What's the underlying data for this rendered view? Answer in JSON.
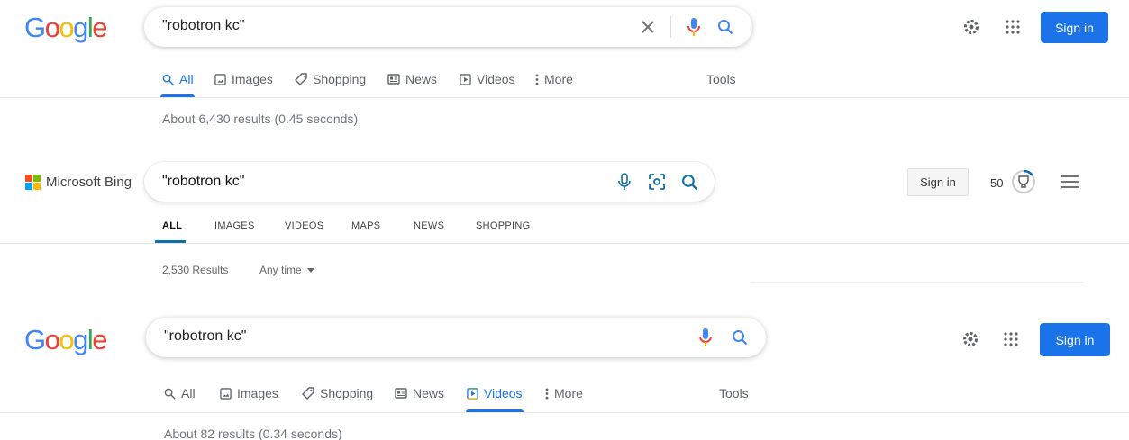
{
  "google1": {
    "logo": "Google",
    "query": "\"robotron kc\"",
    "tabs": [
      {
        "label": "All",
        "icon": "search-icon",
        "active": true
      },
      {
        "label": "Images",
        "icon": "image-icon"
      },
      {
        "label": "Shopping",
        "icon": "tag-icon"
      },
      {
        "label": "News",
        "icon": "news-icon"
      },
      {
        "label": "Videos",
        "icon": "play-icon"
      },
      {
        "label": "More",
        "icon": "vertical-dots-icon"
      }
    ],
    "tools": "Tools",
    "stats": "About 6,430 results (0.45 seconds)",
    "sign_in": "Sign in"
  },
  "bing": {
    "logo": "Microsoft Bing",
    "query": "\"robotron kc\"",
    "tabs": [
      {
        "label": "ALL",
        "active": true
      },
      {
        "label": "IMAGES"
      },
      {
        "label": "VIDEOS"
      },
      {
        "label": "MAPS"
      },
      {
        "label": "NEWS"
      },
      {
        "label": "SHOPPING"
      }
    ],
    "stats": "2,530 Results",
    "time_filter": "Any time",
    "sign_in": "Sign in",
    "points": "50",
    "colors": {
      "tab_underline": "#0f6fa8"
    }
  },
  "google2": {
    "logo": "Google",
    "query": "\"robotron kc\"",
    "tabs": [
      {
        "label": "All",
        "icon": "search-icon"
      },
      {
        "label": "Images",
        "icon": "image-icon"
      },
      {
        "label": "Shopping",
        "icon": "tag-icon"
      },
      {
        "label": "News",
        "icon": "news-icon"
      },
      {
        "label": "Videos",
        "icon": "play-icon",
        "active": true
      },
      {
        "label": "More",
        "icon": "vertical-dots-icon"
      }
    ],
    "tools": "Tools",
    "stats": "About 82 results (0.34 seconds)",
    "sign_in": "Sign in"
  },
  "colors": {
    "google_blue": "#1a73e8"
  }
}
